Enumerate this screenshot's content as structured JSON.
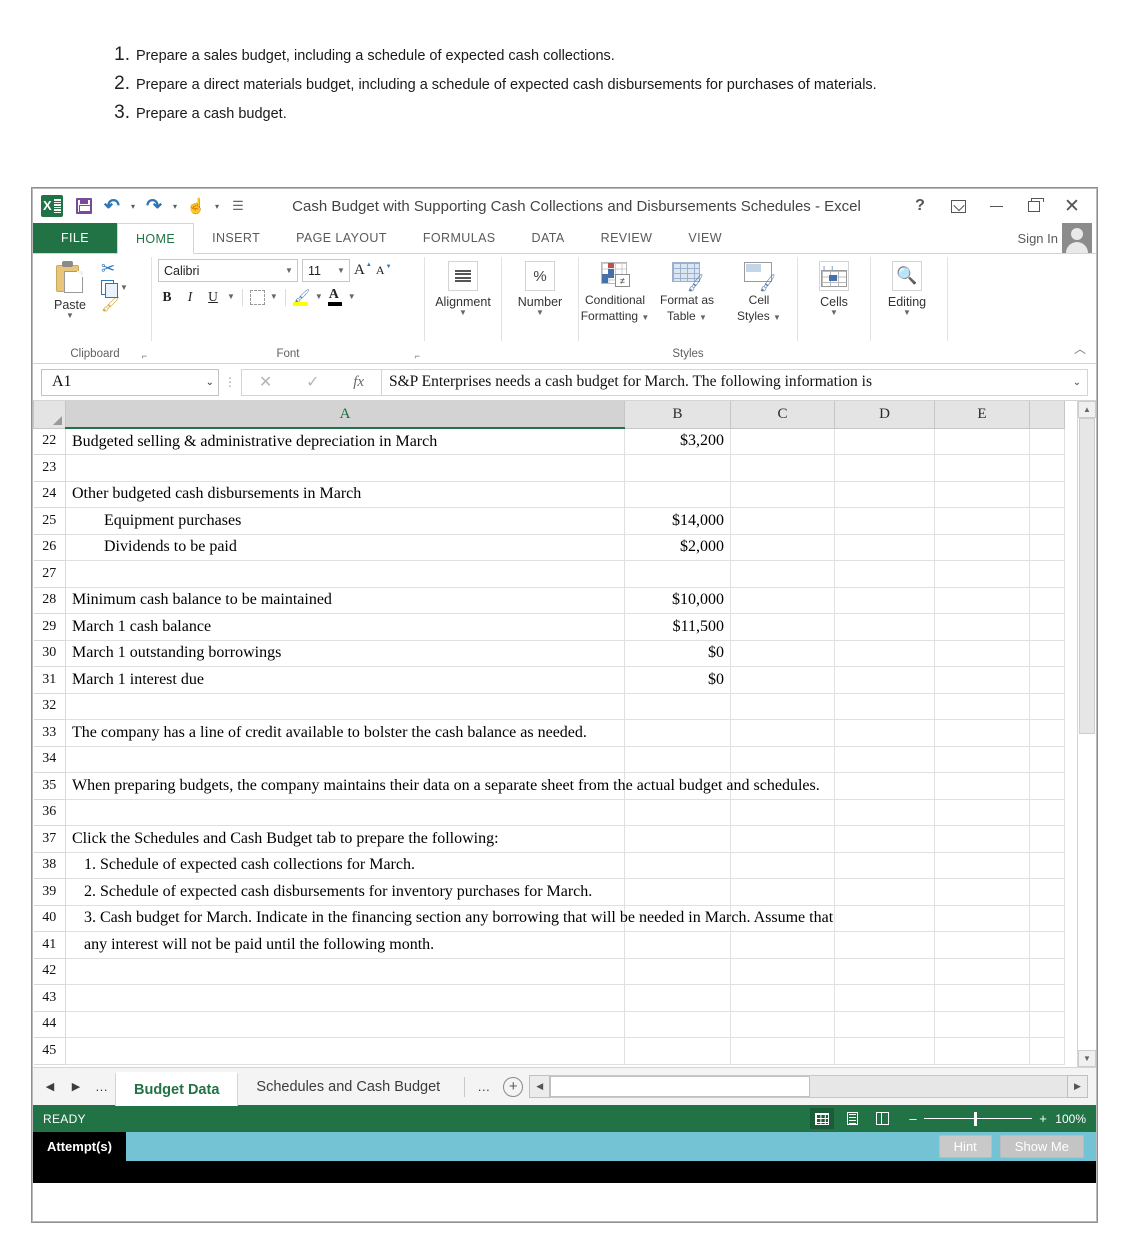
{
  "instructions": [
    {
      "num": "1.",
      "text": "Prepare a sales budget, including a schedule of expected cash collections."
    },
    {
      "num": "2.",
      "text": "Prepare a direct materials budget, including a schedule of expected cash disbursements for purchases of materials."
    },
    {
      "num": "3.",
      "text": "Prepare a cash budget."
    }
  ],
  "window": {
    "title": "Cash Budget with Supporting Cash Collections and Disbursements Schedules - Excel",
    "help_label": "?",
    "ribbon_display_label": "Ribbon Display Options",
    "minimize_label": "Minimize",
    "restore_label": "Restore Down",
    "close_label": "Close"
  },
  "quick_access": {
    "save": "Save",
    "undo": "Undo",
    "redo": "Redo",
    "touch_mode": "Touch/Mouse Mode",
    "customize": "Customize Quick Access Toolbar"
  },
  "ribbon": {
    "tabs": [
      {
        "label": "FILE",
        "active": false
      },
      {
        "label": "HOME",
        "active": true
      },
      {
        "label": "INSERT",
        "active": false
      },
      {
        "label": "PAGE LAYOUT",
        "active": false
      },
      {
        "label": "FORMULAS",
        "active": false
      },
      {
        "label": "DATA",
        "active": false
      },
      {
        "label": "REVIEW",
        "active": false
      },
      {
        "label": "VIEW",
        "active": false
      }
    ],
    "sign_in": "Sign In",
    "groups": {
      "clipboard": {
        "label": "Clipboard",
        "paste": "Paste",
        "cut": "Cut",
        "copy": "Copy",
        "format_painter": "Format Painter"
      },
      "font": {
        "label": "Font",
        "font_name": "Calibri",
        "font_size": "11",
        "grow": "Increase Font Size",
        "shrink": "Decrease Font Size",
        "bold": "B",
        "italic": "I",
        "underline": "U",
        "borders": "Borders",
        "fill_color": "Fill Color",
        "font_color": "Font Color"
      },
      "alignment": {
        "label": "Alignment"
      },
      "number": {
        "label": "Number",
        "icon": "%"
      },
      "styles": {
        "label": "Styles",
        "conditional_formatting": "Conditional\nFormatting",
        "conditional_formatting_l1": "Conditional",
        "conditional_formatting_l2": "Formatting",
        "format_as_table_l1": "Format as",
        "format_as_table_l2": "Table",
        "cell_styles_l1": "Cell",
        "cell_styles_l2": "Styles",
        "neq_symbol": "≠"
      },
      "cells": {
        "label": "Cells"
      },
      "editing": {
        "label": "Editing"
      }
    }
  },
  "formula_bar": {
    "name_box": "A1",
    "cancel": "Cancel",
    "enter": "Enter",
    "insert_function": "fx",
    "content": "S&P Enterprises needs a cash budget for March. The following information is"
  },
  "grid": {
    "columns": [
      "A",
      "B",
      "C",
      "D",
      "E",
      ""
    ],
    "selected_column": "A",
    "rows": [
      {
        "n": "22",
        "a": "Budgeted selling & administrative depreciation in March",
        "b": "$3,200"
      },
      {
        "n": "23",
        "a": "",
        "b": ""
      },
      {
        "n": "24",
        "a": "Other budgeted cash disbursements in March",
        "b": ""
      },
      {
        "n": "25",
        "a": "Equipment purchases",
        "b": "$14,000",
        "indent": true
      },
      {
        "n": "26",
        "a": "Dividends to be paid",
        "b": "$2,000",
        "indent": true
      },
      {
        "n": "27",
        "a": "",
        "b": ""
      },
      {
        "n": "28",
        "a": "Minimum cash balance to be maintained",
        "b": "$10,000"
      },
      {
        "n": "29",
        "a": "March 1 cash balance",
        "b": "$11,500"
      },
      {
        "n": "30",
        "a": "March 1 outstanding borrowings",
        "b": "$0"
      },
      {
        "n": "31",
        "a": "March 1 interest due",
        "b": "$0"
      },
      {
        "n": "32",
        "a": "",
        "b": ""
      },
      {
        "n": "33",
        "a": "The company has a line of credit available to bolster the cash balance as needed.",
        "b": "",
        "spill": true
      },
      {
        "n": "34",
        "a": "",
        "b": ""
      },
      {
        "n": "35",
        "a": "When preparing budgets, the company maintains their data on a separate sheet from the actual budget and schedules.",
        "b": "",
        "spill": true
      },
      {
        "n": "36",
        "a": "",
        "b": ""
      },
      {
        "n": "37",
        "a": "Click the Schedules and Cash Budget tab to prepare the following:",
        "b": "",
        "spill": true
      },
      {
        "n": "38",
        "a": "1. Schedule of expected cash collections for March.",
        "b": "",
        "spill": true,
        "pad": true
      },
      {
        "n": "39",
        "a": "2. Schedule of expected cash disbursements for inventory purchases for March.",
        "b": "",
        "spill": true,
        "pad": true
      },
      {
        "n": "40",
        "a": "3. Cash budget for March. Indicate in the financing section any borrowing that will be needed in March.  Assume that",
        "b": "",
        "spill": true,
        "pad": true
      },
      {
        "n": "41",
        "a": "any interest will not be paid until the following month.",
        "b": "",
        "spill": true,
        "pad": true
      },
      {
        "n": "42",
        "a": "",
        "b": ""
      },
      {
        "n": "43",
        "a": "",
        "b": ""
      },
      {
        "n": "44",
        "a": "",
        "b": ""
      },
      {
        "n": "45",
        "a": "",
        "b": ""
      }
    ]
  },
  "sheet_tabs": {
    "first": "First Sheet",
    "prev": "Previous Sheet",
    "dots_left": "…",
    "tabs": [
      {
        "label": "Budget Data",
        "active": true
      },
      {
        "label": "Schedules and Cash Budget",
        "active": false
      }
    ],
    "dots_right": "…",
    "new_sheet": "+"
  },
  "status_bar": {
    "mode": "READY",
    "view_normal": "Normal View",
    "view_page_layout": "Page Layout View",
    "view_page_break": "Page Break Preview",
    "zoom_out": "–",
    "zoom_in": "+",
    "zoom_level": "100%"
  },
  "attempt_bar": {
    "label": "Attempt(s)",
    "hint": "Hint",
    "show_me": "Show Me"
  },
  "colors": {
    "excel_green": "#217346",
    "accent_blue": "#2e75b6",
    "attempt_teal": "#74c3d5"
  }
}
